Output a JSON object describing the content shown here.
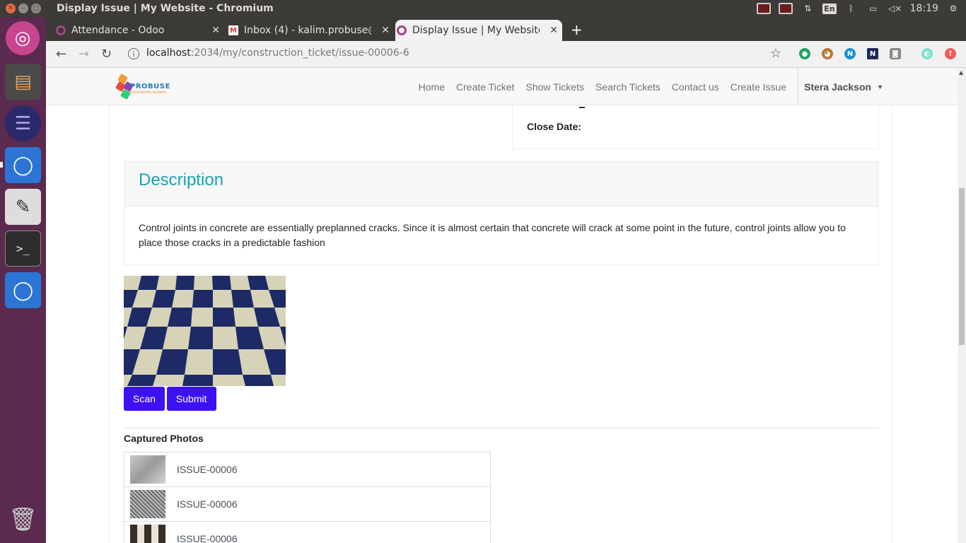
{
  "os": {
    "window_title": "Display Issue | My Website - Chromium",
    "tray": {
      "lang": "En",
      "time": "18:19"
    }
  },
  "browser": {
    "tabs": [
      {
        "label": "Attendance - Odoo"
      },
      {
        "label": "Inbox (4) - kalim.probuse@"
      },
      {
        "label": "Display Issue | My Website"
      }
    ],
    "url_host": "localhost",
    "url_rest": ":2034/my/construction_ticket/issue-00006-6"
  },
  "site": {
    "logo_text": "PROBUSE",
    "logo_sub": "PROFESSIONAL BUSINESS",
    "menu": [
      {
        "label": "Home"
      },
      {
        "label": "Create Ticket"
      },
      {
        "label": "Show Tickets"
      },
      {
        "label": "Search Tickets"
      },
      {
        "label": "Contact us"
      },
      {
        "label": "Create Issue"
      }
    ],
    "user": "Stera Jackson"
  },
  "issue": {
    "close_date_label": "Close Date:",
    "description_title": "Description",
    "description_text": "Control joints in concrete are essentially preplanned cracks. Since it is almost certain that concrete will crack at some point in the future, control joints allow you to place those cracks in a predictable fashion",
    "scan_label": "Scan",
    "submit_label": "Submit",
    "captured_title": "Captured Photos",
    "photos": [
      {
        "name": "ISSUE-00006"
      },
      {
        "name": "ISSUE-00006"
      },
      {
        "name": "ISSUE-00006"
      }
    ]
  }
}
